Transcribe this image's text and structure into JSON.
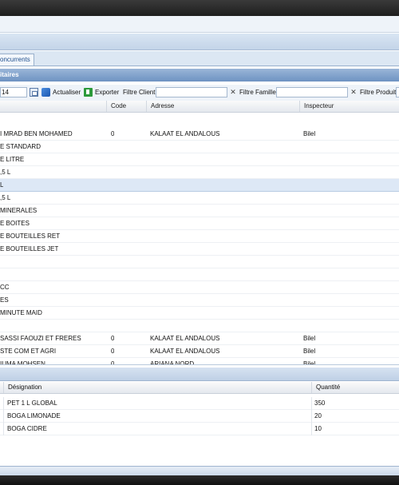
{
  "tabs": [
    {
      "label": "oncurrents"
    }
  ],
  "panel": {
    "title": "itaires"
  },
  "toolbar": {
    "date_value": "14",
    "refresh_label": "Actualiser",
    "export_label": "Exporter",
    "client_filter_label": "Filtre Client:",
    "family_filter_label": "Filtre Famille:",
    "product_filter_label": "Filtre Produit:",
    "clear_symbol": "✕"
  },
  "main_grid": {
    "columns": [
      "Code",
      "Adresse",
      "Inspecteur"
    ],
    "rows": [
      {
        "name": "I MRAD BEN MOHAMED",
        "code": "0",
        "address": "KALAAT EL ANDALOUS",
        "inspector": "Bilel"
      },
      {
        "name": "E STANDARD",
        "code": "",
        "address": "",
        "inspector": ""
      },
      {
        "name": "E LITRE",
        "code": "",
        "address": "",
        "inspector": ""
      },
      {
        "name": ",5 L",
        "code": "",
        "address": "",
        "inspector": ""
      },
      {
        "name": " L",
        "code": "",
        "address": "",
        "inspector": "",
        "selected": true
      },
      {
        "name": ",5 L",
        "code": "",
        "address": "",
        "inspector": ""
      },
      {
        "name": " MINERALES",
        "code": "",
        "address": "",
        "inspector": ""
      },
      {
        "name": "E BOITES",
        "code": "",
        "address": "",
        "inspector": ""
      },
      {
        "name": "E BOUTEILLES RET",
        "code": "",
        "address": "",
        "inspector": ""
      },
      {
        "name": "E BOUTEILLES JET",
        "code": "",
        "address": "",
        "inspector": ""
      },
      {
        "name": "",
        "code": "",
        "address": "",
        "inspector": ""
      },
      {
        "name": "",
        "code": "",
        "address": "",
        "inspector": ""
      },
      {
        "name": " CC",
        "code": "",
        "address": "",
        "inspector": ""
      },
      {
        "name": "ES",
        "code": "",
        "address": "",
        "inspector": ""
      },
      {
        "name": "MINUTE MAID",
        "code": "",
        "address": "",
        "inspector": ""
      },
      {
        "name": "",
        "code": "",
        "address": "",
        "inspector": ""
      },
      {
        "name": " SASSI FAOUZI ET FRERES",
        "code": "0",
        "address": "KALAAT EL ANDALOUS",
        "inspector": "Bilel"
      },
      {
        "name": " STE COM ET AGRI",
        "code": "0",
        "address": "KALAAT EL ANDALOUS",
        "inspector": "Bilel"
      },
      {
        "name": "IUMA MOHSEN",
        "code": "0",
        "address": "ARIANA NORD",
        "inspector": "Bilel"
      }
    ]
  },
  "detail_grid": {
    "columns": [
      "Désignation",
      "Quantité"
    ],
    "rows": [
      {
        "designation": "PET 1 L GLOBAL",
        "quantity": "350"
      },
      {
        "designation": "BOGA LIMONADE",
        "quantity": "20"
      },
      {
        "designation": "BOGA CIDRE",
        "quantity": "10"
      }
    ]
  }
}
